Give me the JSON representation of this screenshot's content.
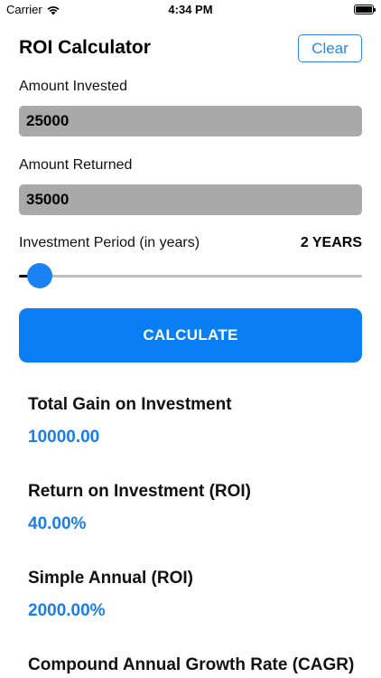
{
  "status_bar": {
    "carrier": "Carrier",
    "time": "4:34 PM",
    "icons": [
      "wifi-icon",
      "battery-icon"
    ]
  },
  "header": {
    "title": "ROI Calculator",
    "clear_label": "Clear"
  },
  "form": {
    "amount_invested": {
      "label": "Amount Invested",
      "value": "25000"
    },
    "amount_returned": {
      "label": "Amount Returned",
      "value": "35000"
    },
    "period": {
      "label": "Investment Period (in years)",
      "value_text": "2 YEARS",
      "slider_fraction": 0.06
    },
    "calculate_label": "CALCULATE"
  },
  "results": [
    {
      "label": "Total Gain on Investment",
      "value": "10000.00"
    },
    {
      "label": "Return on Investment (ROI)",
      "value": "40.00%"
    },
    {
      "label": "Simple Annual (ROI)",
      "value": "2000.00%"
    },
    {
      "label": "Compound Annual Growth Rate (CAGR)",
      "value": ""
    }
  ],
  "colors": {
    "accent": "#0a7ef5",
    "result_value": "#1a7ee6",
    "input_bg": "#a9a9a9"
  }
}
